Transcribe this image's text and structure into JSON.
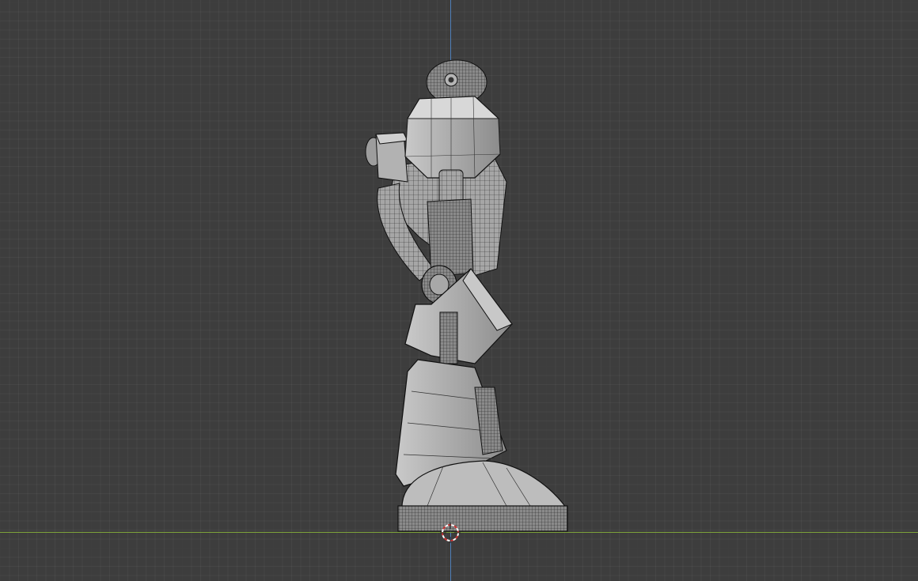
{
  "viewport": {
    "background_color": "#3d3d3d",
    "axis_colors": {
      "x": "#7da23a",
      "y": "#4f7fb8"
    },
    "mesh_fill": "#9a9a9a",
    "wire_color": "#1a1a1a",
    "cursor_colors": [
      "#cc3333",
      "#ffffff"
    ]
  },
  "icons": {
    "cursor": "3d-cursor-icon"
  }
}
